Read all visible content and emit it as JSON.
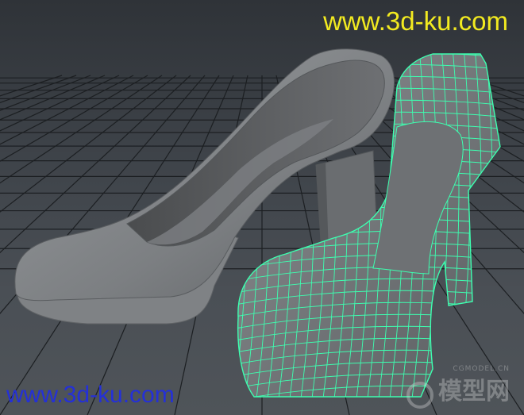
{
  "watermarks": {
    "top": "www.3d-ku.com",
    "bottom": "www.3d-ku.com",
    "logo_small": "CGMODEL.CN",
    "logo_big": "模型网"
  },
  "colors": {
    "watermark_top": "#f2ea20",
    "watermark_bottom": "#2430d8",
    "wireframe": "#3dffb0",
    "shoe_shaded": "#8a8d90",
    "grid": "#1c1f22"
  },
  "objects": [
    "shaded-high-heel-shoe",
    "wireframe-high-heel-shoe"
  ]
}
